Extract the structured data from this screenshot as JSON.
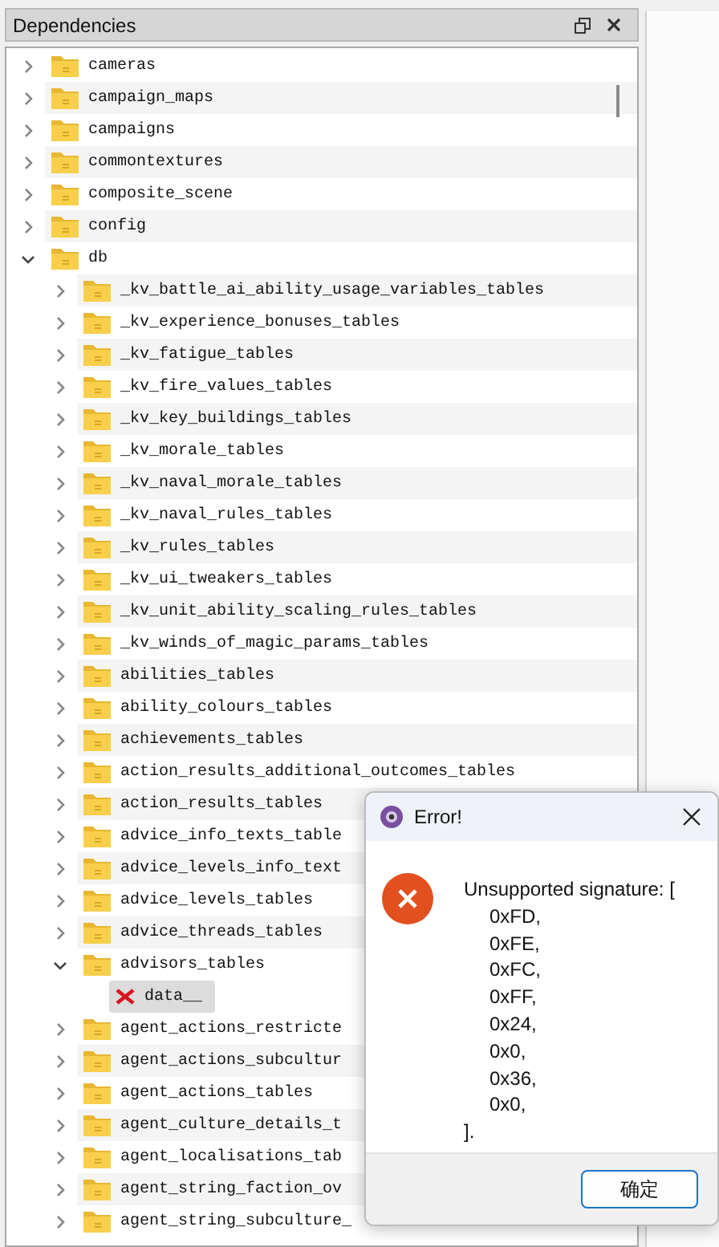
{
  "dock": {
    "title": "Dependencies"
  },
  "tree": [
    {
      "name": "cameras",
      "kind": "folder",
      "expanded": false,
      "selected": false
    },
    {
      "name": "campaign_maps",
      "kind": "folder",
      "expanded": false,
      "selected": false
    },
    {
      "name": "campaigns",
      "kind": "folder",
      "expanded": false,
      "selected": false
    },
    {
      "name": "commontextures",
      "kind": "folder",
      "expanded": false,
      "selected": false
    },
    {
      "name": "composite_scene",
      "kind": "folder",
      "expanded": false,
      "selected": false
    },
    {
      "name": "config",
      "kind": "folder",
      "expanded": false,
      "selected": false
    },
    {
      "name": "db",
      "kind": "folder",
      "expanded": true,
      "selected": false,
      "children": [
        {
          "name": "_kv_battle_ai_ability_usage_variables_tables",
          "kind": "folder",
          "expanded": false,
          "selected": false
        },
        {
          "name": "_kv_experience_bonuses_tables",
          "kind": "folder",
          "expanded": false,
          "selected": false
        },
        {
          "name": "_kv_fatigue_tables",
          "kind": "folder",
          "expanded": false,
          "selected": false
        },
        {
          "name": "_kv_fire_values_tables",
          "kind": "folder",
          "expanded": false,
          "selected": false
        },
        {
          "name": "_kv_key_buildings_tables",
          "kind": "folder",
          "expanded": false,
          "selected": false
        },
        {
          "name": "_kv_morale_tables",
          "kind": "folder",
          "expanded": false,
          "selected": false
        },
        {
          "name": "_kv_naval_morale_tables",
          "kind": "folder",
          "expanded": false,
          "selected": false
        },
        {
          "name": "_kv_naval_rules_tables",
          "kind": "folder",
          "expanded": false,
          "selected": false
        },
        {
          "name": "_kv_rules_tables",
          "kind": "folder",
          "expanded": false,
          "selected": false
        },
        {
          "name": "_kv_ui_tweakers_tables",
          "kind": "folder",
          "expanded": false,
          "selected": false
        },
        {
          "name": "_kv_unit_ability_scaling_rules_tables",
          "kind": "folder",
          "expanded": false,
          "selected": false
        },
        {
          "name": "_kv_winds_of_magic_params_tables",
          "kind": "folder",
          "expanded": false,
          "selected": false
        },
        {
          "name": "abilities_tables",
          "kind": "folder",
          "expanded": false,
          "selected": false
        },
        {
          "name": "ability_colours_tables",
          "kind": "folder",
          "expanded": false,
          "selected": false
        },
        {
          "name": "achievements_tables",
          "kind": "folder",
          "expanded": false,
          "selected": false
        },
        {
          "name": "action_results_additional_outcomes_tables",
          "kind": "folder",
          "expanded": false,
          "selected": false
        },
        {
          "name": "action_results_tables",
          "kind": "folder",
          "expanded": false,
          "selected": false
        },
        {
          "name": "advice_info_texts_table",
          "kind": "folder",
          "expanded": false,
          "selected": false
        },
        {
          "name": "advice_levels_info_text",
          "kind": "folder",
          "expanded": false,
          "selected": false
        },
        {
          "name": "advice_levels_tables",
          "kind": "folder",
          "expanded": false,
          "selected": false
        },
        {
          "name": "advice_threads_tables",
          "kind": "folder",
          "expanded": false,
          "selected": false
        },
        {
          "name": "advisors_tables",
          "kind": "folder",
          "expanded": true,
          "selected": false,
          "children": [
            {
              "name": "data__",
              "kind": "error-file",
              "selected": true
            }
          ]
        },
        {
          "name": "agent_actions_restricte",
          "kind": "folder",
          "expanded": false,
          "selected": false
        },
        {
          "name": "agent_actions_subcultur",
          "kind": "folder",
          "expanded": false,
          "selected": false
        },
        {
          "name": "agent_actions_tables",
          "kind": "folder",
          "expanded": false,
          "selected": false
        },
        {
          "name": "agent_culture_details_t",
          "kind": "folder",
          "expanded": false,
          "selected": false
        },
        {
          "name": "agent_localisations_tab",
          "kind": "folder",
          "expanded": false,
          "selected": false
        },
        {
          "name": "agent_string_faction_ov",
          "kind": "folder",
          "expanded": false,
          "selected": false
        },
        {
          "name": "agent_string_subculture_",
          "kind": "folder",
          "expanded": false,
          "selected": false
        }
      ]
    }
  ],
  "dialog": {
    "title": "Error!",
    "message": "Unsupported signature: [",
    "values": [
      "0xFD,",
      "0xFE,",
      "0xFC,",
      "0xFF,",
      "0x24,",
      "0x0,",
      "0x36,",
      "0x0,"
    ],
    "closing": "].",
    "button": "确定"
  }
}
